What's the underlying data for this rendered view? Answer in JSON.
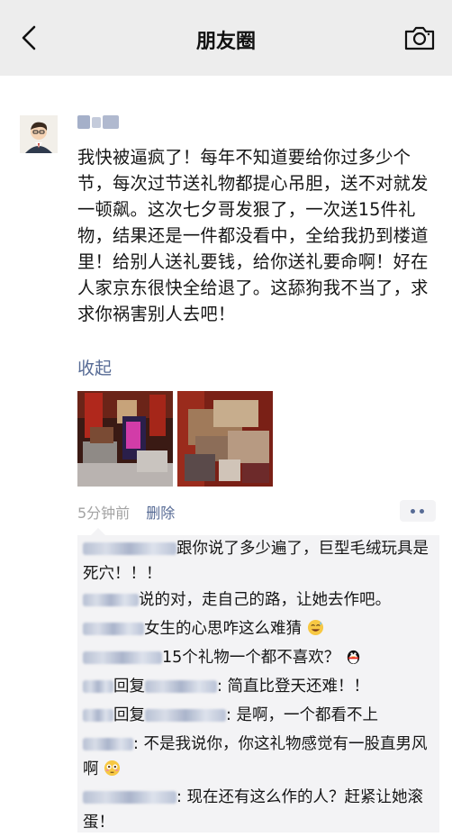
{
  "nav": {
    "title": "朋友圈"
  },
  "post": {
    "text": "我快被逼疯了！每年不知道要给你过多少个节，每次过节送礼物都提心吊胆，送不对就发一顿飙。这次七夕哥发狠了，一次送15件礼物，结果还是一件都没看中，全给我扔到楼道里！给别人送礼要钱，给你送礼要命啊！好在人家京东很快全给退了。这舔狗我不当了，求求你祸害别人去吧！",
    "collapse_label": "收起",
    "time": "5分钟前",
    "delete_label": "删除"
  },
  "comments": [
    {
      "sep": "",
      "text": "跟你说了多少遍了，巨型毛绒玩具是死穴！！！"
    },
    {
      "sep": "",
      "text": "说的对，走自己的路，让她去作吧。"
    },
    {
      "sep": "",
      "text": "女生的心思咋这么难猜"
    },
    {
      "sep": "",
      "text": "15个礼物一个都不喜欢？"
    },
    {
      "reply": "回复",
      "sep": ": ",
      "text": "简直比登天还难！！"
    },
    {
      "reply": "回复",
      "sep": ": ",
      "text": "是啊，一个都看不上"
    },
    {
      "sep": ": ",
      "text": "不是我说你，你这礼物感觉有一股直男风啊"
    },
    {
      "sep": ": ",
      "text": "现在还有这么作的人？赶紧让她滚蛋！"
    }
  ]
}
